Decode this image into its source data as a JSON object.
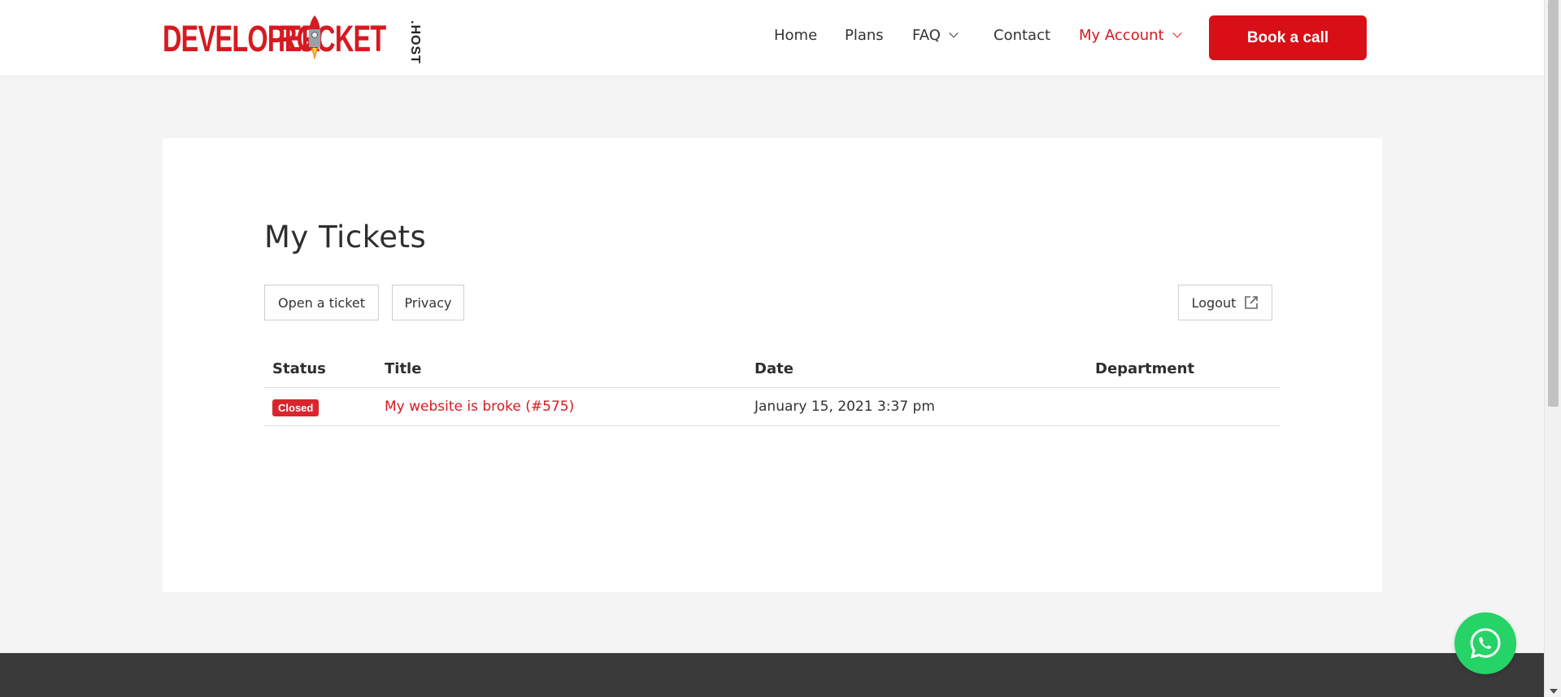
{
  "header": {
    "logo": {
      "word1": "DEVELOPER",
      "word2": "ROCKET",
      "suffix": ".HOST"
    },
    "nav": {
      "home": "Home",
      "plans": "Plans",
      "faq": "FAQ",
      "contact": "Contact",
      "my_account": "My Account"
    },
    "cta": "Book a call"
  },
  "main": {
    "title": "My Tickets",
    "buttons": {
      "open_ticket": "Open a ticket",
      "privacy": "Privacy",
      "logout": "Logout"
    },
    "table": {
      "columns": [
        "Status",
        "Title",
        "Date",
        "Department"
      ],
      "rows": [
        {
          "status": "Closed",
          "title": "My website is broke (#575)",
          "date": "January 15, 2021 3:37 pm",
          "department": ""
        }
      ]
    }
  },
  "colors": {
    "brand_red": "#d71920",
    "whatsapp_green": "#25d366",
    "footer": "#3a3a3a"
  },
  "icons": {
    "logout": "external-link-icon",
    "chat": "whatsapp-icon",
    "dropdown": "chevron-down-icon"
  }
}
